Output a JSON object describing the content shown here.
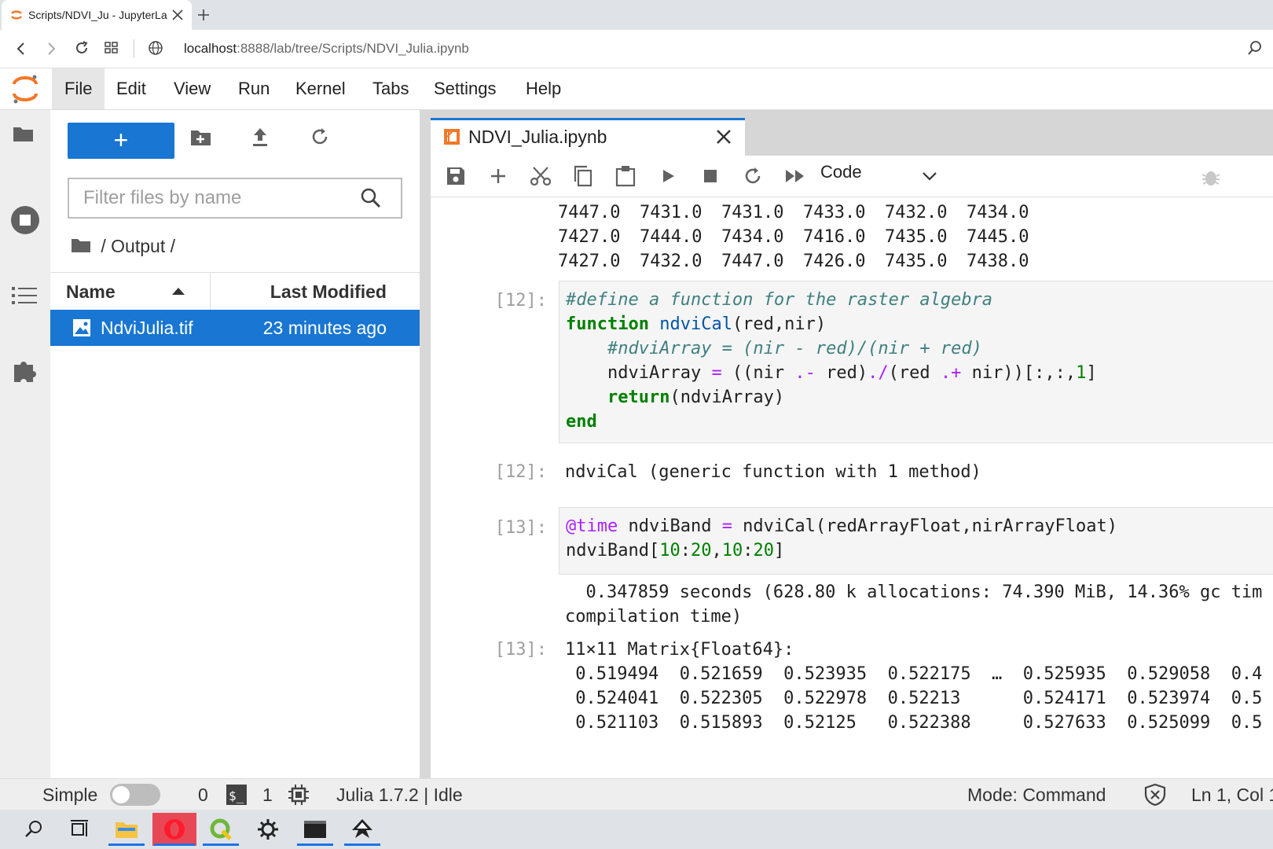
{
  "browser": {
    "tab_title": "Scripts/NDVI_Ju - JupyterLa",
    "url_host": "localhost",
    "url_path": ":8888/lab/tree/Scripts/NDVI_Julia.ipynb"
  },
  "menubar": {
    "items": [
      "File",
      "Edit",
      "View",
      "Run",
      "Kernel",
      "Tabs",
      "Settings",
      "Help"
    ]
  },
  "filebrowser": {
    "new_label": "+",
    "filter_placeholder": "Filter files by name",
    "breadcrumb": "/ Output /",
    "col_name": "Name",
    "col_modified": "Last Modified",
    "files": [
      {
        "name": "NdviJulia.tif",
        "modified": "23 minutes ago"
      }
    ]
  },
  "notebook": {
    "tab_title": "NDVI_Julia.ipynb",
    "cell_type": "Code",
    "top_output": [
      [
        "7447.0",
        "7431.0",
        "7431.0",
        "7433.0",
        "7432.0",
        "7434.0"
      ],
      [
        "7427.0",
        "7444.0",
        "7434.0",
        "7416.0",
        "7435.0",
        "7445.0"
      ],
      [
        "7427.0",
        "7432.0",
        "7447.0",
        "7426.0",
        "7435.0",
        "7438.0"
      ]
    ],
    "cell12": {
      "in_prompt": "[12]:",
      "out_prompt": "[12]:",
      "output": "ndviCal (generic function with 1 method)"
    },
    "cell13": {
      "in_prompt": "[13]:",
      "out_prompt": "[13]:",
      "stdout_line1": "  0.347859 seconds (628.80 k allocations: 74.390 MiB, 14.36% gc tim",
      "stdout_line2": "compilation time)",
      "matrix_header": "11×11 Matrix{Float64}:",
      "matrix_rows": [
        " 0.519494  0.521659  0.523935  0.522175  …  0.525935  0.529058  0.4",
        " 0.524041  0.522305  0.522978  0.52213      0.524171  0.523974  0.5",
        " 0.521103  0.515893  0.52125   0.522388     0.527633  0.525099  0.5"
      ]
    }
  },
  "statusbar": {
    "simple_label": "Simple",
    "terminals": "0",
    "kernels": "1",
    "kernel_status": "Julia 1.7.2 | Idle",
    "mode": "Mode: Command",
    "position": "Ln 1, Col 1"
  },
  "colors": {
    "accent": "#1976d2",
    "code_bg": "#f5f5f5",
    "keyword": "#008000",
    "comment": "#408080"
  }
}
